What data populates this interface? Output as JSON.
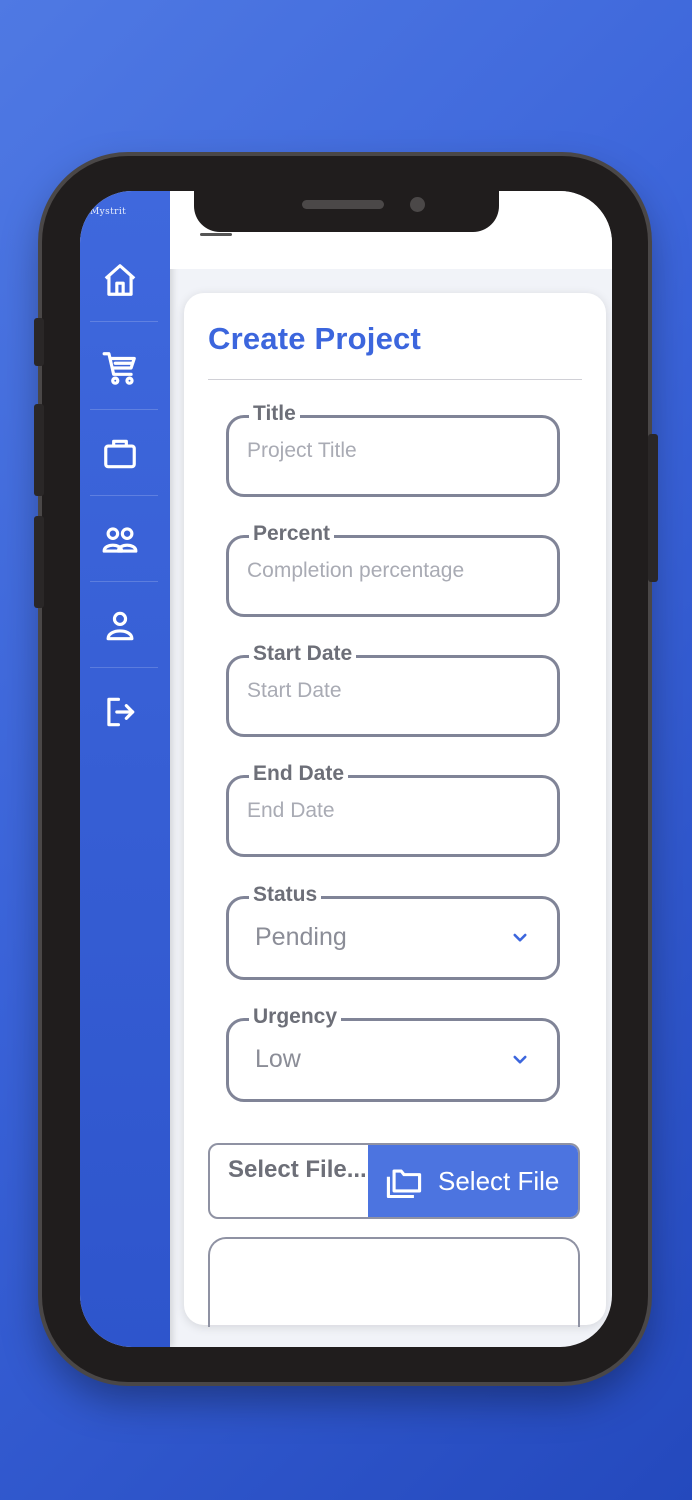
{
  "app": {
    "brand": "Mystrit"
  },
  "sidebar": {
    "items": [
      {
        "name": "home",
        "icon": "home-icon"
      },
      {
        "name": "cart",
        "icon": "cart-icon"
      },
      {
        "name": "projects",
        "icon": "briefcase-icon"
      },
      {
        "name": "teams",
        "icon": "users-icon"
      },
      {
        "name": "profile",
        "icon": "user-icon"
      },
      {
        "name": "logout",
        "icon": "logout-icon"
      }
    ]
  },
  "form": {
    "title": "Create Project",
    "fields": {
      "title": {
        "label": "Title",
        "placeholder": "Project Title"
      },
      "percent": {
        "label": "Percent",
        "placeholder": "Completion percentage"
      },
      "start_date": {
        "label": "Start Date",
        "placeholder": "Start Date"
      },
      "end_date": {
        "label": "End Date",
        "placeholder": "End Date"
      },
      "status": {
        "label": "Status",
        "value": "Pending"
      },
      "urgency": {
        "label": "Urgency",
        "value": "Low"
      }
    },
    "file": {
      "placeholder": "Select File...",
      "button_label": "Select File"
    }
  },
  "colors": {
    "accent": "#3c66dd",
    "sidebar": "#2e55cc",
    "field_border": "#808497"
  }
}
